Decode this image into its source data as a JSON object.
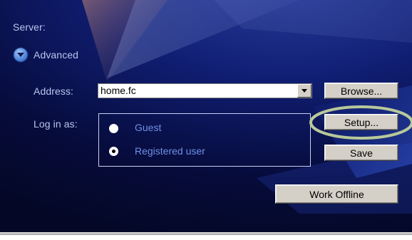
{
  "server": {
    "label": "Server:"
  },
  "advanced": {
    "label": "Advanced",
    "icon": "chevron-down-circle-icon"
  },
  "address": {
    "label": "Address:",
    "value": "home.fc",
    "dropdown_icon": "dropdown-arrow-icon",
    "browse_label": "Browse..."
  },
  "login": {
    "label": "Log in as:",
    "options": [
      {
        "label": "Guest",
        "selected": false
      },
      {
        "label": "Registered user",
        "selected": true
      }
    ]
  },
  "buttons": {
    "setup_label": "Setup...",
    "save_label": "Save",
    "offline_label": "Work Offline"
  },
  "colors": {
    "panel_bg": "#0a1250",
    "label_text": "#b9c6ee",
    "radio_text": "#6f8fe6",
    "highlight_ring": "#b8c89a"
  }
}
